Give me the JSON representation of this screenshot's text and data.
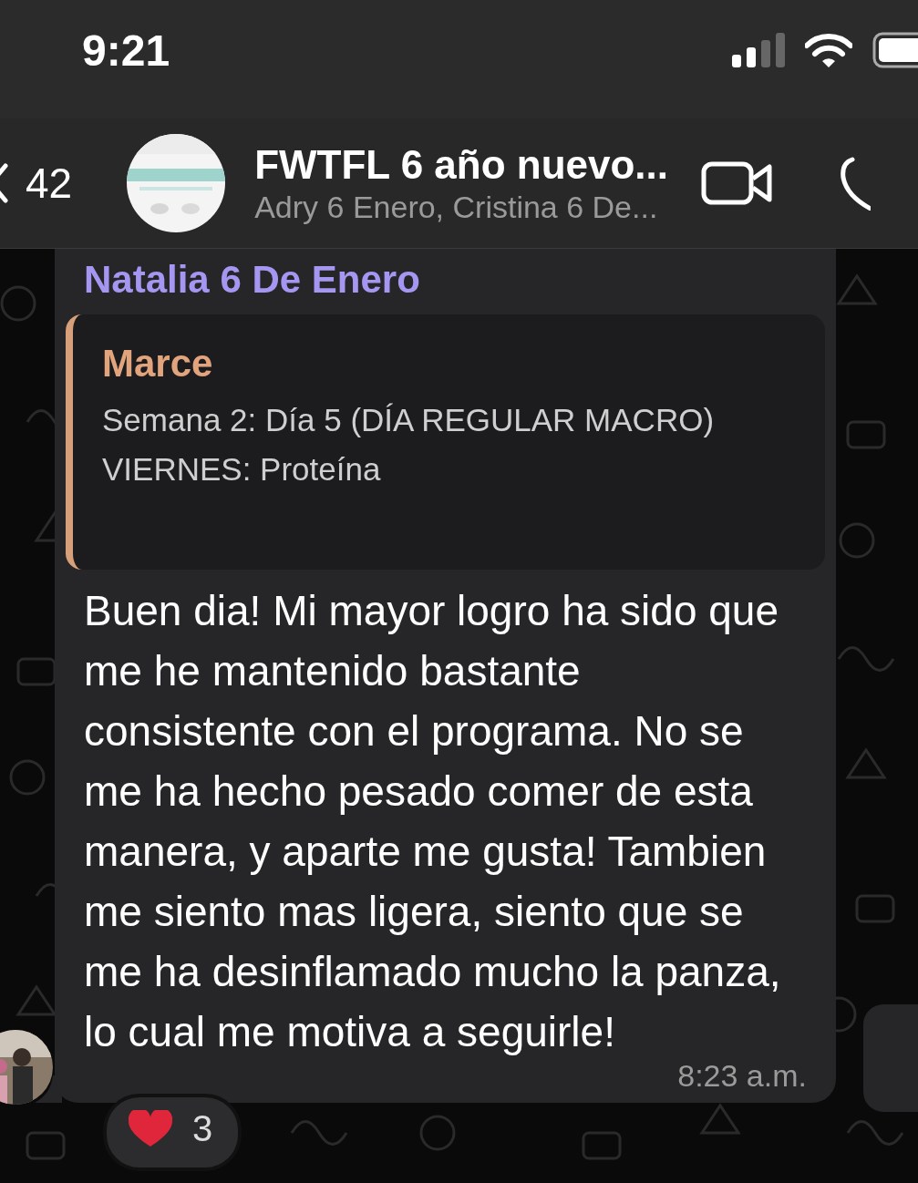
{
  "status_bar": {
    "time": "9:21"
  },
  "header": {
    "back_count": "42",
    "title": "FWTFL 6 año nuevo...",
    "subtitle": "Adry 6 Enero, Cristina 6 De..."
  },
  "message": {
    "sender": "Natalia 6 De Enero",
    "quote": {
      "author": "Marce",
      "lines": [
        "Semana 2: Día 5 (DÍA REGULAR MACRO)",
        "VIERNES: Proteína"
      ]
    },
    "text": "Buen dia! Mi mayor logro ha sido que me he mantenido bastante consistente con el programa. No se me ha hecho pesado comer de esta manera, y aparte me gusta! Tambien me siento mas ligera, siento que se me ha desinflamado mucho la panza, lo cual me motiva a seguirle!",
    "time": "8:23 a.m.",
    "reactions": [
      {
        "count": "3"
      }
    ]
  }
}
